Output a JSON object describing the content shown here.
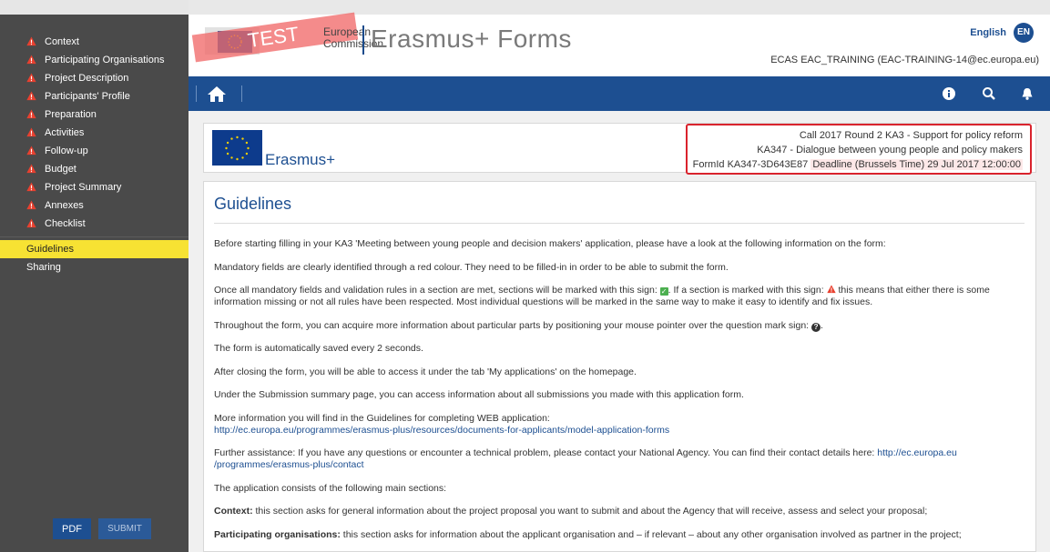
{
  "sidebar": {
    "sections": [
      {
        "label": "Context"
      },
      {
        "label": "Participating Organisations"
      },
      {
        "label": "Project Description"
      },
      {
        "label": "Participants' Profile"
      },
      {
        "label": "Preparation"
      },
      {
        "label": "Activities"
      },
      {
        "label": "Follow-up"
      },
      {
        "label": "Budget"
      },
      {
        "label": "Project Summary"
      },
      {
        "label": "Annexes"
      },
      {
        "label": "Checklist"
      }
    ],
    "guidelines_label": "Guidelines",
    "sharing_label": "Sharing",
    "pdf_label": "PDF",
    "submit_label": "SUBMIT"
  },
  "header": {
    "test_label": "TEST",
    "ec_line1": "European",
    "ec_line2": "Commission",
    "app_title": "Erasmus+ Forms",
    "language": "English",
    "language_code": "EN",
    "user": "ECAS EAC_TRAINING (EAC-TRAINING-14@ec.europa.eu)"
  },
  "navbar": {
    "icons": [
      "home-icon",
      "info-icon",
      "search-icon",
      "bell-icon"
    ]
  },
  "programme": {
    "name": "Erasmus+",
    "call_line": "Call 2017  Round 2  KA3 - Support for policy reform",
    "action_line": "KA347 - Dialogue between young people and policy makers",
    "form_id": "FormId KA347-3D643E87",
    "deadline": "Deadline (Brussels Time) 29 Jul 2017 12:00:00"
  },
  "guidelines": {
    "title": "Guidelines",
    "p1": "Before starting filling in your KA3 'Meeting between young people and decision makers' application, please have a look at the following information on the form:",
    "p2": "Mandatory fields are clearly identified through a red colour. They need to be filled-in in order to be able to submit the form.",
    "p3a": "Once all mandatory fields and validation rules in a section are met, sections will be marked with this sign:",
    "p3b": ". If a section is marked with this sign:",
    "p3c": "this means that either there is some information missing or not all rules have been respected. Most individual questions will be marked in the same way to make it easy to identify and fix issues.",
    "p4": "Throughout the form, you can acquire more information about particular parts by positioning your mouse pointer over the question mark sign:",
    "p5": "The form is automatically saved every 2 seconds.",
    "p6": "After closing the form, you will be able to access it under the tab 'My applications' on the homepage.",
    "p7": "Under the Submission summary page, you can access information about all submissions you made with this application form.",
    "p8": "More information you will find in the Guidelines for completing WEB application:",
    "p8_link": "http://ec.europa.eu/programmes/erasmus-plus/resources/documents-for-applicants/model-application-forms",
    "p9": "Further assistance: If you have any questions or encounter a technical problem, please contact your National Agency. You can find their contact details here:",
    "p9_link_a": "http://ec.europa.eu",
    "p9_link_b": "/programmes/erasmus-plus/contact",
    "p10": "The application consists of the following main sections:",
    "context_bold": "Context:",
    "context_text": "this section asks for general information about the project proposal you want to submit and about the Agency that will receive, assess and select your proposal;",
    "partorg_bold": "Participating organisations:",
    "partorg_text": "this section asks for information about the applicant organisation and – if relevant – about any other organisation involved as partner in the project;"
  },
  "colors": {
    "sidebar_bg": "#4a4a4a",
    "brand_blue": "#1d4f91",
    "active_yellow": "#f7e233",
    "warning_red": "#d9232d"
  }
}
